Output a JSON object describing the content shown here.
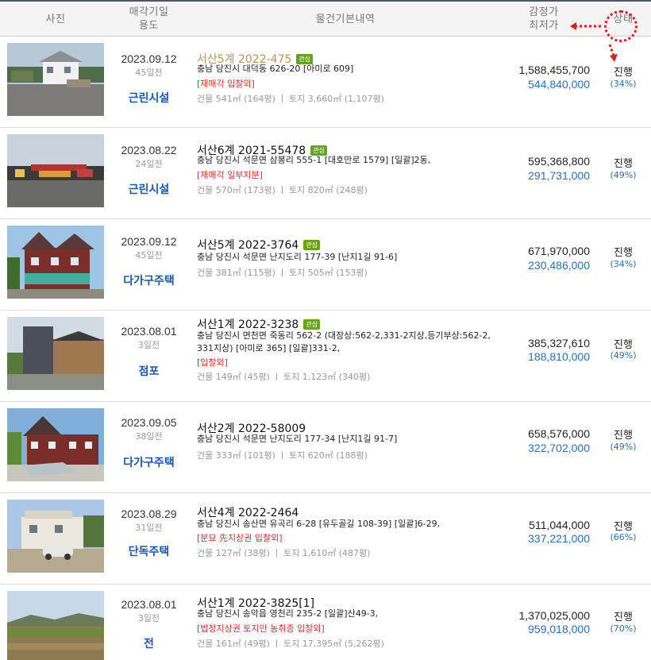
{
  "header": {
    "photo": "사진",
    "date_line1": "매각기일",
    "date_line2": "용도",
    "info": "물건기본내역",
    "price_line1": "감정가",
    "price_line2": "최저가",
    "status": "상태"
  },
  "colors": {
    "accent": "#1a56b4",
    "minimum_price": "#2a6fc2",
    "note_red": "#e03030",
    "tag_green": "#63a31f",
    "hint_red": "#e21b1b"
  },
  "items": [
    {
      "date": "2023.09.12",
      "elapsed": "45일전",
      "usage": "근린시설",
      "case": "서산5계 2022-475",
      "tag": "관심",
      "address": "충남 당진시 대덕동 626-20 [아미로 609]",
      "notes": "[재매각   입찰외]",
      "area": "건물 541㎡ (164평)   ㅣ  토지 3,660㎡ (1,107평)",
      "appraised": "1,588,455,700",
      "minimum": "544,840,000",
      "status": "진행",
      "ratio": "(34%)"
    },
    {
      "date": "2023.08.22",
      "elapsed": "24일전",
      "usage": "근린시설",
      "case": "서산6계 2021-55478",
      "tag": "관심",
      "address": "충남 당진시 석문면 삼봉리 555-1 [대호만로 1579]  [일괄]2동,",
      "notes": "[재매각   일부지분]",
      "area": "건물 570㎡ (173평)   ㅣ  토지 820㎡ (248평)",
      "appraised": "595,368,800",
      "minimum": "291,731,000",
      "status": "진행",
      "ratio": "(49%)"
    },
    {
      "date": "2023.09.12",
      "elapsed": "45일전",
      "usage": "다가구주택",
      "case": "서산5계 2022-3764",
      "tag": "관심",
      "address": "충남 당진시 석문면 난지도리 177-39 [난지1길 91-6]",
      "notes": "",
      "area": "건물 381㎡ (115평)   ㅣ  토지 505㎡ (153평)",
      "appraised": "671,970,000",
      "minimum": "230,486,000",
      "status": "진행",
      "ratio": "(34%)"
    },
    {
      "date": "2023.08.01",
      "elapsed": "3일전",
      "usage": "점포",
      "case": "서산1계 2022-3238",
      "tag": "관심",
      "address": "충남 당진시 면천면 죽동리 562-2 (대장상:562-2,331-2지상,등기부상:562-2, 331지상) [아미로 365]  [일괄]331-2,",
      "notes": "[입찰외]",
      "area": "건물 149㎡ (45평)   ㅣ  토지 1,123㎡ (340평)",
      "appraised": "385,327,610",
      "minimum": "188,810,000",
      "status": "진행",
      "ratio": "(49%)"
    },
    {
      "date": "2023.09.05",
      "elapsed": "38일전",
      "usage": "다가구주택",
      "case": "서산2계 2022-58009",
      "tag": "",
      "address": "충남 당진시 석문면 난지도리 177-34 [난지1길 91-7]",
      "notes": "",
      "area": "건물 333㎡ (101평)   ㅣ  토지 620㎡ (188평)",
      "appraised": "658,576,000",
      "minimum": "322,702,000",
      "status": "진행",
      "ratio": "(49%)"
    },
    {
      "date": "2023.08.29",
      "elapsed": "31일전",
      "usage": "단독주택",
      "case": "서산4계 2022-2464",
      "tag": "",
      "address": "충남 당진시 송산면 유곡리 6-28 [유두골길 108-39]  [일괄]6-29,",
      "notes": "[분묘   先지상권   입찰외]",
      "area": "건물 127㎡ (38평)   ㅣ  토지 1,610㎡ (487평)",
      "appraised": "511,044,000",
      "minimum": "337,221,000",
      "status": "진행",
      "ratio": "(66%)"
    },
    {
      "date": "2023.08.01",
      "elapsed": "3일전",
      "usage": "전",
      "case": "서산1계 2022-3825[1]",
      "tag": "",
      "address": "충남 당진시 송악읍 영천리 235-2  [일괄]산49-3,",
      "notes": "[법정지상권   토지만   농취증   입찰외]",
      "area": "건물 161㎡ (49평)   ㅣ  토지 17,395㎡ (5,262평)",
      "appraised": "1,370,025,000",
      "minimum": "959,018,000",
      "status": "진행",
      "ratio": "(70%)"
    }
  ]
}
